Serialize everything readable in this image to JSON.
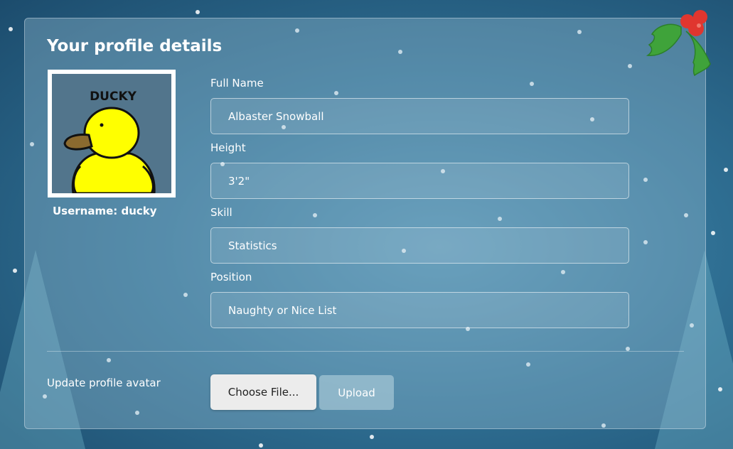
{
  "profile": {
    "title": "Your profile details",
    "avatar_text": "DUCKY",
    "username_label": "Username: ducky"
  },
  "fields": {
    "full_name": {
      "label": "Full Name",
      "value": "Albaster Snowball"
    },
    "height": {
      "label": "Height",
      "value": "3'2\""
    },
    "skill": {
      "label": "Skill",
      "value": "Statistics"
    },
    "position": {
      "label": "Position",
      "value": "Naughty or Nice List"
    }
  },
  "avatar_upload": {
    "label": "Update profile avatar",
    "choose_label": "Choose File...",
    "upload_label": "Upload"
  },
  "decorations": {
    "holly_icon": "holly-icon",
    "colors": {
      "accent_red": "#e0362f",
      "leaf_green": "#3fa33a",
      "duck_yellow": "#ffff00"
    }
  }
}
